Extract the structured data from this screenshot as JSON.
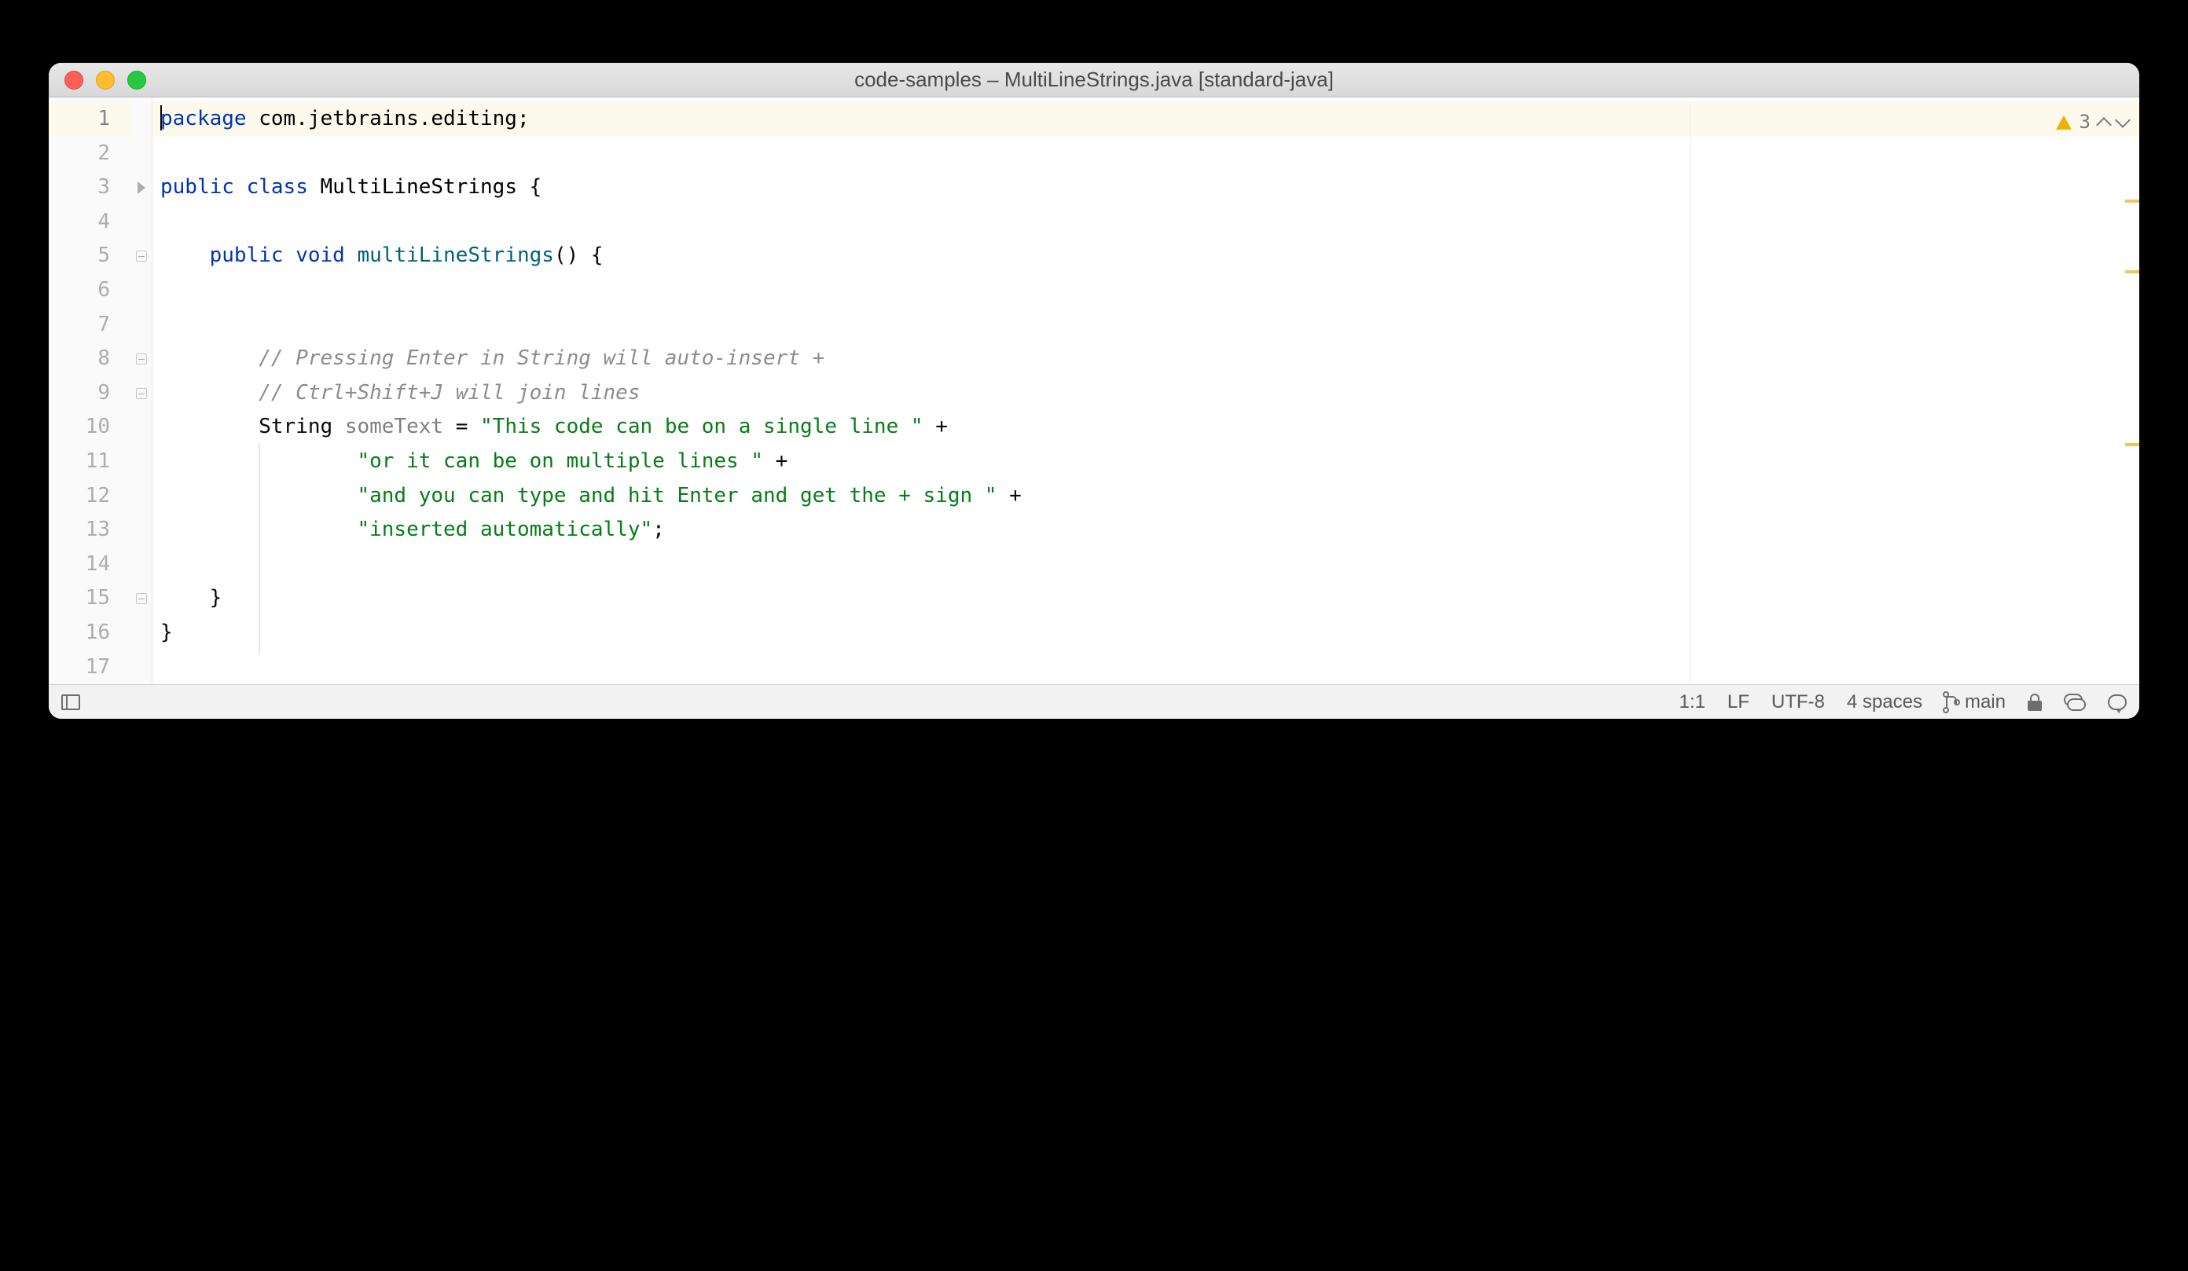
{
  "window": {
    "title": "code-samples – MultiLineStrings.java [standard-java]"
  },
  "inspection": {
    "warning_count": "3"
  },
  "gutter": {
    "lines": [
      "1",
      "2",
      "3",
      "4",
      "5",
      "6",
      "7",
      "8",
      "9",
      "10",
      "11",
      "12",
      "13",
      "14",
      "15",
      "16",
      "17"
    ],
    "current": 1
  },
  "code": {
    "line1": {
      "kw": "package",
      "pkg": " com.jetbrains.editing;"
    },
    "line3": {
      "kw1": "public",
      "kw2": "class",
      "name": "MultiLineStrings",
      "brace": "{"
    },
    "line5": {
      "kw1": "public",
      "kw2": "void",
      "method": "multiLineStrings",
      "sig": "() {"
    },
    "line8": {
      "comment": "// Pressing Enter in String will auto-insert +"
    },
    "line9": {
      "comment": "// Ctrl+Shift+J will join lines"
    },
    "line10": {
      "type": "String",
      "var": "someText",
      "eq": " = ",
      "str": "\"This code can be on a single line \"",
      "plus": " +"
    },
    "line11": {
      "str": "\"or it can be on multiple lines \"",
      "plus": " +"
    },
    "line12": {
      "str": "\"and you can type and hit Enter and get the + sign \"",
      "plus": " +"
    },
    "line13": {
      "str": "\"inserted automatically\"",
      "semi": ";"
    },
    "line15": {
      "brace": "}"
    },
    "line16": {
      "brace": "}"
    }
  },
  "status": {
    "cursor": "1:1",
    "line_sep": "LF",
    "encoding": "UTF-8",
    "indent": "4 spaces",
    "branch": "main"
  }
}
